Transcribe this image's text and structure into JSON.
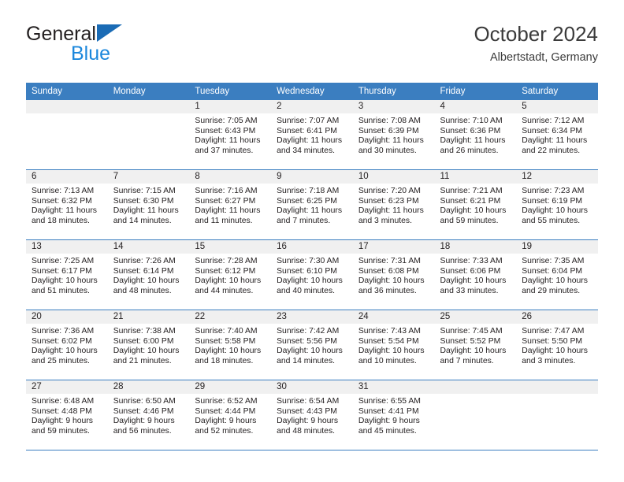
{
  "brand": {
    "line1": "General",
    "line2": "Blue",
    "triangle_color": "#1a6bb5",
    "line2_color": "#1b87dc"
  },
  "header": {
    "title": "October 2024",
    "subtitle": "Albertstadt, Germany"
  },
  "theme": {
    "header_blue": "#3b7ec0",
    "daynum_band": "#f0f0f0",
    "text": "#231f20"
  },
  "weekday_headers": [
    "Sunday",
    "Monday",
    "Tuesday",
    "Wednesday",
    "Thursday",
    "Friday",
    "Saturday"
  ],
  "weeks": [
    [
      {
        "day": "",
        "sunrise": "",
        "sunset": "",
        "daylight_line1": "",
        "daylight_line2": ""
      },
      {
        "day": "",
        "sunrise": "",
        "sunset": "",
        "daylight_line1": "",
        "daylight_line2": ""
      },
      {
        "day": "1",
        "sunrise": "Sunrise: 7:05 AM",
        "sunset": "Sunset: 6:43 PM",
        "daylight_line1": "Daylight: 11 hours",
        "daylight_line2": "and 37 minutes."
      },
      {
        "day": "2",
        "sunrise": "Sunrise: 7:07 AM",
        "sunset": "Sunset: 6:41 PM",
        "daylight_line1": "Daylight: 11 hours",
        "daylight_line2": "and 34 minutes."
      },
      {
        "day": "3",
        "sunrise": "Sunrise: 7:08 AM",
        "sunset": "Sunset: 6:39 PM",
        "daylight_line1": "Daylight: 11 hours",
        "daylight_line2": "and 30 minutes."
      },
      {
        "day": "4",
        "sunrise": "Sunrise: 7:10 AM",
        "sunset": "Sunset: 6:36 PM",
        "daylight_line1": "Daylight: 11 hours",
        "daylight_line2": "and 26 minutes."
      },
      {
        "day": "5",
        "sunrise": "Sunrise: 7:12 AM",
        "sunset": "Sunset: 6:34 PM",
        "daylight_line1": "Daylight: 11 hours",
        "daylight_line2": "and 22 minutes."
      }
    ],
    [
      {
        "day": "6",
        "sunrise": "Sunrise: 7:13 AM",
        "sunset": "Sunset: 6:32 PM",
        "daylight_line1": "Daylight: 11 hours",
        "daylight_line2": "and 18 minutes."
      },
      {
        "day": "7",
        "sunrise": "Sunrise: 7:15 AM",
        "sunset": "Sunset: 6:30 PM",
        "daylight_line1": "Daylight: 11 hours",
        "daylight_line2": "and 14 minutes."
      },
      {
        "day": "8",
        "sunrise": "Sunrise: 7:16 AM",
        "sunset": "Sunset: 6:27 PM",
        "daylight_line1": "Daylight: 11 hours",
        "daylight_line2": "and 11 minutes."
      },
      {
        "day": "9",
        "sunrise": "Sunrise: 7:18 AM",
        "sunset": "Sunset: 6:25 PM",
        "daylight_line1": "Daylight: 11 hours",
        "daylight_line2": "and 7 minutes."
      },
      {
        "day": "10",
        "sunrise": "Sunrise: 7:20 AM",
        "sunset": "Sunset: 6:23 PM",
        "daylight_line1": "Daylight: 11 hours",
        "daylight_line2": "and 3 minutes."
      },
      {
        "day": "11",
        "sunrise": "Sunrise: 7:21 AM",
        "sunset": "Sunset: 6:21 PM",
        "daylight_line1": "Daylight: 10 hours",
        "daylight_line2": "and 59 minutes."
      },
      {
        "day": "12",
        "sunrise": "Sunrise: 7:23 AM",
        "sunset": "Sunset: 6:19 PM",
        "daylight_line1": "Daylight: 10 hours",
        "daylight_line2": "and 55 minutes."
      }
    ],
    [
      {
        "day": "13",
        "sunrise": "Sunrise: 7:25 AM",
        "sunset": "Sunset: 6:17 PM",
        "daylight_line1": "Daylight: 10 hours",
        "daylight_line2": "and 51 minutes."
      },
      {
        "day": "14",
        "sunrise": "Sunrise: 7:26 AM",
        "sunset": "Sunset: 6:14 PM",
        "daylight_line1": "Daylight: 10 hours",
        "daylight_line2": "and 48 minutes."
      },
      {
        "day": "15",
        "sunrise": "Sunrise: 7:28 AM",
        "sunset": "Sunset: 6:12 PM",
        "daylight_line1": "Daylight: 10 hours",
        "daylight_line2": "and 44 minutes."
      },
      {
        "day": "16",
        "sunrise": "Sunrise: 7:30 AM",
        "sunset": "Sunset: 6:10 PM",
        "daylight_line1": "Daylight: 10 hours",
        "daylight_line2": "and 40 minutes."
      },
      {
        "day": "17",
        "sunrise": "Sunrise: 7:31 AM",
        "sunset": "Sunset: 6:08 PM",
        "daylight_line1": "Daylight: 10 hours",
        "daylight_line2": "and 36 minutes."
      },
      {
        "day": "18",
        "sunrise": "Sunrise: 7:33 AM",
        "sunset": "Sunset: 6:06 PM",
        "daylight_line1": "Daylight: 10 hours",
        "daylight_line2": "and 33 minutes."
      },
      {
        "day": "19",
        "sunrise": "Sunrise: 7:35 AM",
        "sunset": "Sunset: 6:04 PM",
        "daylight_line1": "Daylight: 10 hours",
        "daylight_line2": "and 29 minutes."
      }
    ],
    [
      {
        "day": "20",
        "sunrise": "Sunrise: 7:36 AM",
        "sunset": "Sunset: 6:02 PM",
        "daylight_line1": "Daylight: 10 hours",
        "daylight_line2": "and 25 minutes."
      },
      {
        "day": "21",
        "sunrise": "Sunrise: 7:38 AM",
        "sunset": "Sunset: 6:00 PM",
        "daylight_line1": "Daylight: 10 hours",
        "daylight_line2": "and 21 minutes."
      },
      {
        "day": "22",
        "sunrise": "Sunrise: 7:40 AM",
        "sunset": "Sunset: 5:58 PM",
        "daylight_line1": "Daylight: 10 hours",
        "daylight_line2": "and 18 minutes."
      },
      {
        "day": "23",
        "sunrise": "Sunrise: 7:42 AM",
        "sunset": "Sunset: 5:56 PM",
        "daylight_line1": "Daylight: 10 hours",
        "daylight_line2": "and 14 minutes."
      },
      {
        "day": "24",
        "sunrise": "Sunrise: 7:43 AM",
        "sunset": "Sunset: 5:54 PM",
        "daylight_line1": "Daylight: 10 hours",
        "daylight_line2": "and 10 minutes."
      },
      {
        "day": "25",
        "sunrise": "Sunrise: 7:45 AM",
        "sunset": "Sunset: 5:52 PM",
        "daylight_line1": "Daylight: 10 hours",
        "daylight_line2": "and 7 minutes."
      },
      {
        "day": "26",
        "sunrise": "Sunrise: 7:47 AM",
        "sunset": "Sunset: 5:50 PM",
        "daylight_line1": "Daylight: 10 hours",
        "daylight_line2": "and 3 minutes."
      }
    ],
    [
      {
        "day": "27",
        "sunrise": "Sunrise: 6:48 AM",
        "sunset": "Sunset: 4:48 PM",
        "daylight_line1": "Daylight: 9 hours",
        "daylight_line2": "and 59 minutes."
      },
      {
        "day": "28",
        "sunrise": "Sunrise: 6:50 AM",
        "sunset": "Sunset: 4:46 PM",
        "daylight_line1": "Daylight: 9 hours",
        "daylight_line2": "and 56 minutes."
      },
      {
        "day": "29",
        "sunrise": "Sunrise: 6:52 AM",
        "sunset": "Sunset: 4:44 PM",
        "daylight_line1": "Daylight: 9 hours",
        "daylight_line2": "and 52 minutes."
      },
      {
        "day": "30",
        "sunrise": "Sunrise: 6:54 AM",
        "sunset": "Sunset: 4:43 PM",
        "daylight_line1": "Daylight: 9 hours",
        "daylight_line2": "and 48 minutes."
      },
      {
        "day": "31",
        "sunrise": "Sunrise: 6:55 AM",
        "sunset": "Sunset: 4:41 PM",
        "daylight_line1": "Daylight: 9 hours",
        "daylight_line2": "and 45 minutes."
      },
      {
        "day": "",
        "sunrise": "",
        "sunset": "",
        "daylight_line1": "",
        "daylight_line2": ""
      },
      {
        "day": "",
        "sunrise": "",
        "sunset": "",
        "daylight_line1": "",
        "daylight_line2": ""
      }
    ]
  ]
}
